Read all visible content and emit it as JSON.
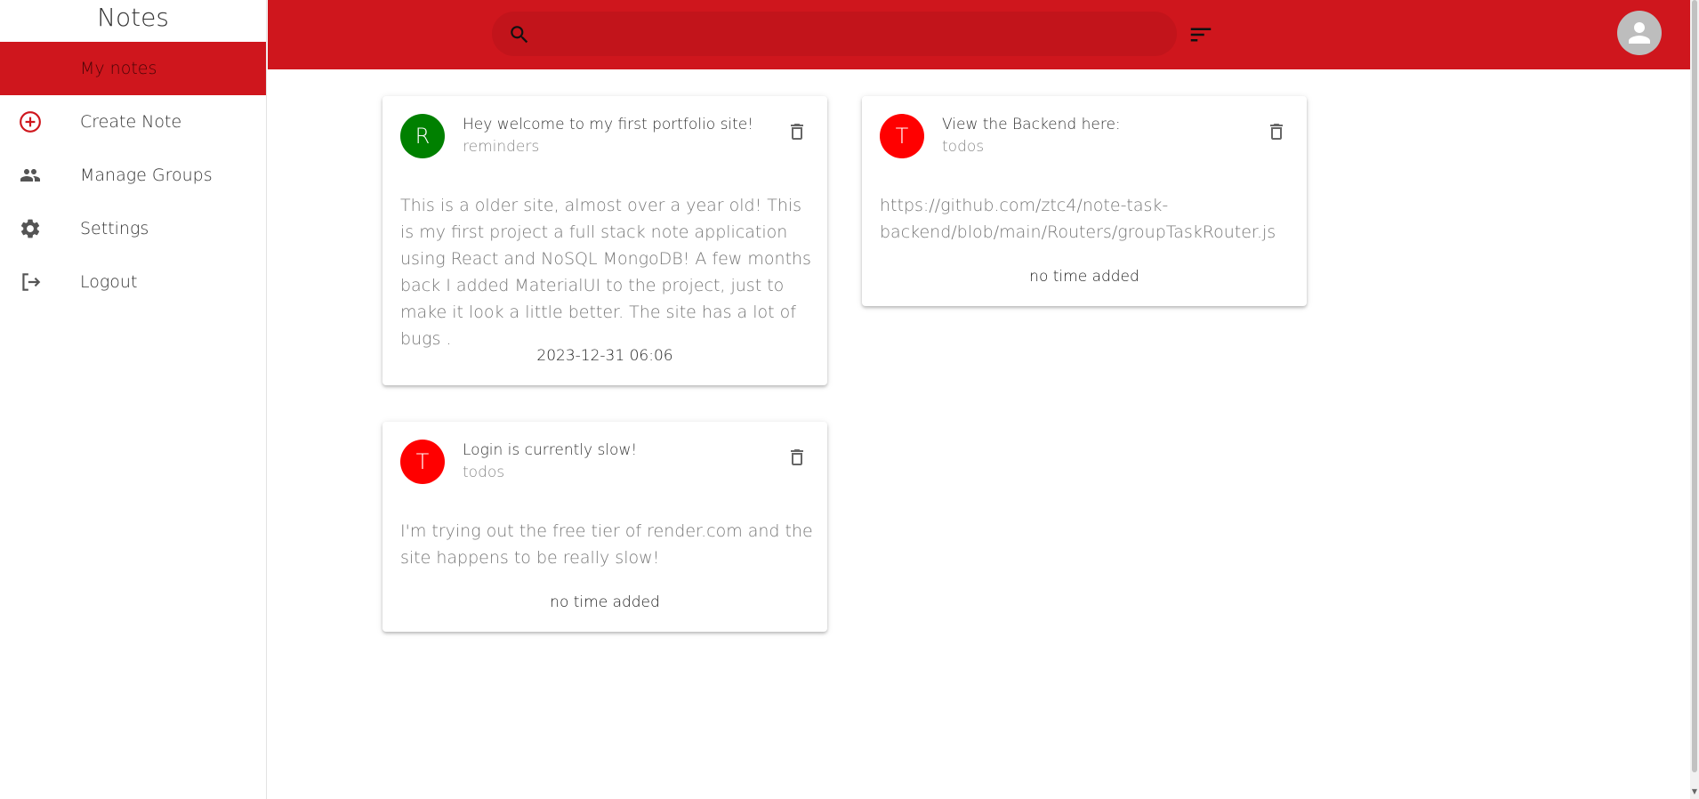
{
  "app": {
    "title": "Notes"
  },
  "sidebar": {
    "items": [
      {
        "label": "My notes",
        "icon": "notes-icon",
        "active": true
      },
      {
        "label": "Create Note",
        "icon": "add-circle-icon"
      },
      {
        "label": "Manage Groups",
        "icon": "people-icon"
      },
      {
        "label": "Settings",
        "icon": "gear-icon"
      },
      {
        "label": "Logout",
        "icon": "logout-icon"
      }
    ]
  },
  "topbar": {
    "search_placeholder": "",
    "search_value": "",
    "accent_color": "#cf161d"
  },
  "notes": [
    {
      "avatar_letter": "R",
      "avatar_color": "#008000",
      "title": "Hey welcome to my first portfolio site!",
      "group": "reminders",
      "body": "This is a older site, almost over a year old! This is my first project a full stack note application using React and NoSQL MongoDB! A few months back I added MaterialUI to the project, just to make it look a little better. The site has a lot of bugs .",
      "time": "2023-12-31 06:06"
    },
    {
      "avatar_letter": "T",
      "avatar_color": "#ff0000",
      "title": "View the Backend here:",
      "group": "todos",
      "body": "https://github.com/ztc4/note-task-backend/blob/main/Routers/groupTaskRouter.js",
      "time": "no time added"
    },
    {
      "avatar_letter": "T",
      "avatar_color": "#ff0000",
      "title": "Login is currently slow!",
      "group": "todos",
      "body": "I'm trying out the free tier of render.com and the site happens to be really slow!",
      "time": "no time added"
    }
  ]
}
